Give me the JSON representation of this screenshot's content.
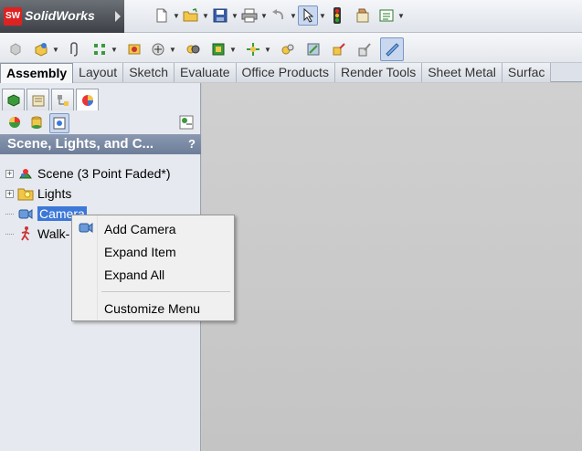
{
  "app": {
    "logo_badge": "SW",
    "name": "SolidWorks"
  },
  "tabs": [
    {
      "label": "Assembly",
      "active": true
    },
    {
      "label": "Layout"
    },
    {
      "label": "Sketch"
    },
    {
      "label": "Evaluate"
    },
    {
      "label": "Office Products"
    },
    {
      "label": "Render Tools"
    },
    {
      "label": "Sheet Metal"
    },
    {
      "label": "Surfac"
    }
  ],
  "panel": {
    "header": "Scene, Lights, and C...",
    "help": "?"
  },
  "tree": [
    {
      "label": "Scene (3 Point Faded*)",
      "icon": "scene-icon",
      "expandable": true
    },
    {
      "label": "Lights",
      "icon": "lights-folder-icon",
      "expandable": true
    },
    {
      "label": "Camera",
      "icon": "camera-icon",
      "expandable": false,
      "selected": true
    },
    {
      "label": "Walk-",
      "icon": "walkthrough-icon",
      "expandable": false
    }
  ],
  "context_menu": {
    "items": [
      {
        "label": "Add Camera",
        "icon": "add-camera-icon"
      },
      {
        "label": "Expand Item"
      },
      {
        "label": "Expand All"
      },
      {
        "label": "Customize Menu"
      }
    ]
  },
  "colors": {
    "selection": "#3c78d8",
    "panel_header": "#7a889f",
    "viewport": "#c8c8c8",
    "logo_red": "#dd2222"
  }
}
